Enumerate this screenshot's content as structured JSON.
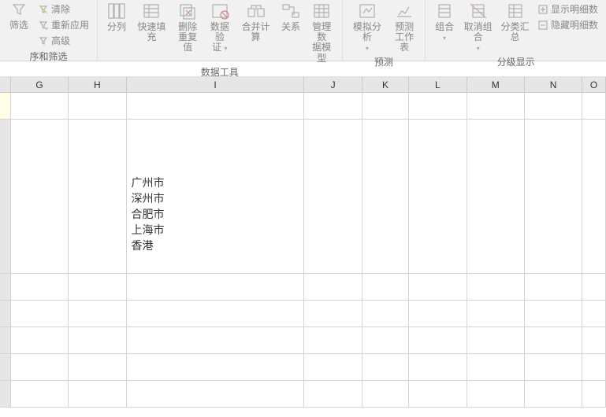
{
  "ribbon": {
    "left": {
      "clear": "清除",
      "reapply": "重新应用",
      "advanced": "高级",
      "filter": "筛选",
      "group_label": "序和筛选"
    },
    "data_tools": {
      "text_to_columns": "分列",
      "flash_fill": "快速填充",
      "remove_dup_l1": "删除",
      "remove_dup_l2": "重复值",
      "data_val_l1": "数据验",
      "data_val_l2": "证",
      "consolidate": "合并计算",
      "relationships": "关系",
      "manage_model_l1": "管理数",
      "manage_model_l2": "据模型",
      "group_label": "数据工具"
    },
    "forecast": {
      "whatif": "模拟分析",
      "forecast_l1": "预测",
      "forecast_l2": "工作表",
      "group_label": "预测"
    },
    "outline": {
      "group": "组合",
      "ungroup": "取消组合",
      "subtotal": "分类汇总",
      "show_detail": "显示明细数",
      "hide_detail": "隐藏明细数",
      "group_label": "分级显示"
    }
  },
  "columns": [
    "G",
    "H",
    "I",
    "J",
    "K",
    "L",
    "M",
    "N",
    "O"
  ],
  "cell_content": {
    "I2": "广州市\n深州市\n合肥市\n上海市\n香港"
  },
  "chart_data": {
    "type": "table",
    "columns": [
      "G",
      "H",
      "I",
      "J",
      "K",
      "L",
      "M",
      "N",
      "O"
    ],
    "rows": [
      {
        "I": ""
      },
      {
        "I": "广州市\n深州市\n合肥市\n上海市\n香港"
      }
    ]
  }
}
